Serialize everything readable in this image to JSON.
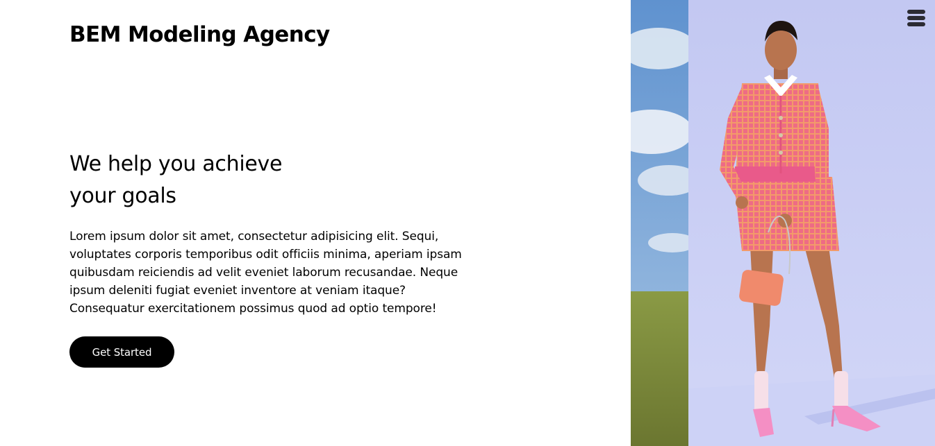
{
  "header": {
    "brand": "BEM Modeling Agency",
    "menu_icon": "hamburger-icon"
  },
  "hero": {
    "headline_lines": [
      "We help you achieve",
      "your goals"
    ],
    "description_lines": [
      "Lorem ipsum dolor sit amet, consectetur adipisicing elit. Sequi,",
      "voluptates corporis temporibus odit officiis minima, aperiam ipsam",
      "quibusdam reiciendis ad velit eveniet laborum recusandae. Neque",
      "ipsum deleniti fugiat eveniet inventore at veniam itaque?",
      "Consequatur exercitationem possimus quod ad optio tempore!"
    ],
    "cta_label": "Get Started"
  },
  "colors": {
    "text": "#000000",
    "button_bg": "#000000",
    "button_text": "#ffffff",
    "backdrop": "#c9cff4",
    "outfit": "#ee6e86",
    "sky": "#6f9fd6",
    "grass": "#7d8a3a"
  }
}
